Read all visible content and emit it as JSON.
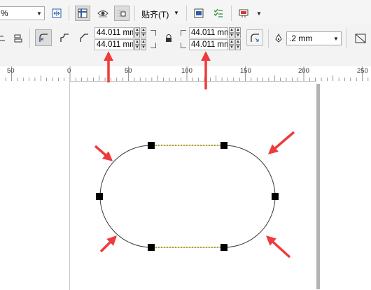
{
  "zoom": {
    "value": "%"
  },
  "toolbar": {
    "snap_label": "贴齐(T)",
    "icons": [
      "view-grid-icon",
      "view-wireframe-icon",
      "eye-icon",
      "snap-grid-icon",
      "snap-to-icon",
      "options-icon",
      "checklist-icon",
      "launch-icon"
    ]
  },
  "property_bar": {
    "corner_fields": [
      {
        "group": "left",
        "top": "44.011 mm",
        "bottom": "44.011 mm"
      },
      {
        "group": "right",
        "top": "44.011 mm",
        "bottom": "44.011 mm"
      }
    ],
    "outline_width": ".2 mm"
  },
  "ruler": {
    "labels": [
      "50",
      "0",
      "50",
      "100",
      "150",
      "200",
      "250"
    ]
  },
  "colors": {
    "accent_arrow": "#ef3b3b",
    "toolbar_bg": "#f3f3f3",
    "shape_outline": "#3a3a3a",
    "shape_highlight": "#f0e000"
  }
}
